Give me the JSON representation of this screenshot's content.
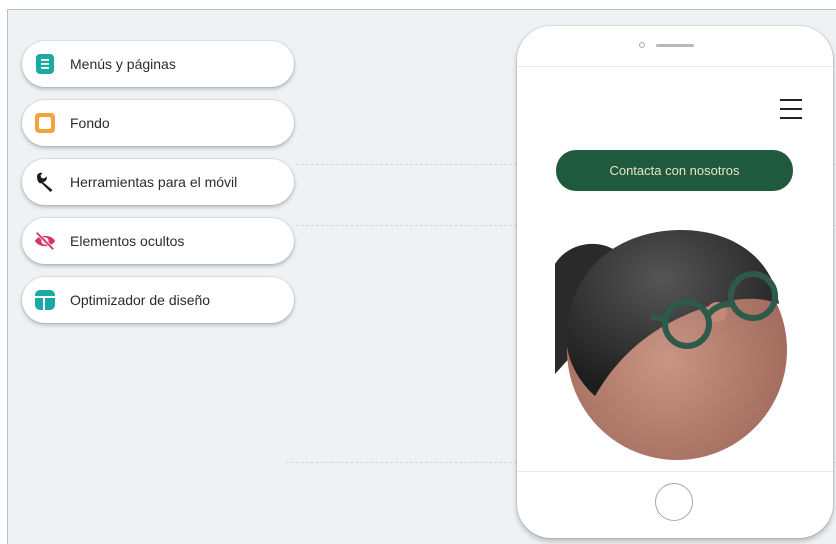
{
  "panel": {
    "items": [
      {
        "label": "Menús y páginas",
        "icon": "pages-icon",
        "color": "#1aa9a5"
      },
      {
        "label": "Fondo",
        "icon": "background-icon",
        "color": "#f5a33c"
      },
      {
        "label": "Herramientas para el móvil",
        "icon": "wrench-icon",
        "color": "#1c1c1c"
      },
      {
        "label": "Elementos ocultos",
        "icon": "hidden-eye-icon",
        "color": "#d6336c"
      },
      {
        "label": "Optimizador de diseño",
        "icon": "layout-optimizer-icon",
        "color": "#1aa9a5"
      }
    ]
  },
  "phone": {
    "cta_label": "Contacta con nosotros",
    "cta_color": "#1f5a3e",
    "menu_icon": "hamburger-menu-icon",
    "illustration": "character-with-glasses-illustration"
  }
}
